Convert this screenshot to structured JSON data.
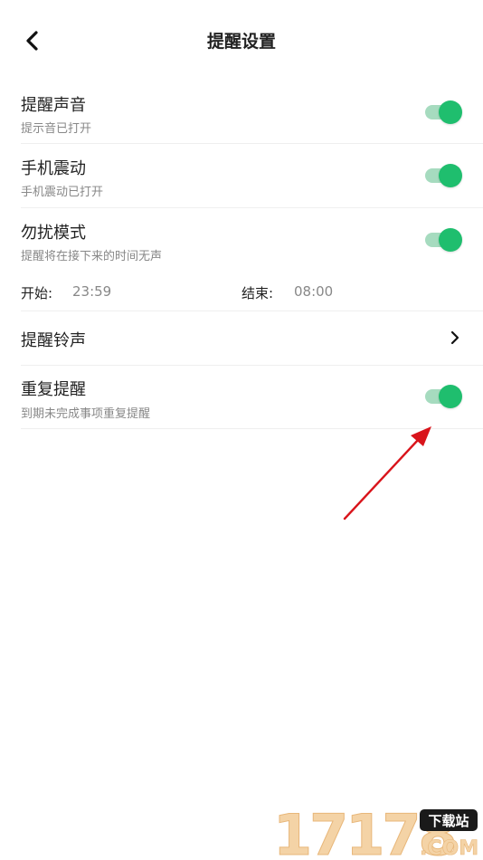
{
  "header": {
    "title": "提醒设置",
    "back_icon": "chevron-left-icon"
  },
  "settings": {
    "sound": {
      "title": "提醒声音",
      "subtitle": "提示音已打开",
      "enabled": true
    },
    "vibrate": {
      "title": "手机震动",
      "subtitle": "手机震动已打开",
      "enabled": true
    },
    "dnd": {
      "title": "勿扰模式",
      "subtitle": "提醒将在接下来的时间无声",
      "enabled": true,
      "start_label": "开始:",
      "start_time": "23:59",
      "end_label": "结束:",
      "end_time": "08:00"
    },
    "ringtone": {
      "title": "提醒铃声",
      "icon": "chevron-right-icon"
    },
    "repeat": {
      "title": "重复提醒",
      "subtitle": "到期未完成事项重复提醒",
      "enabled": true
    }
  },
  "colors": {
    "toggle_on": "#1fbe6e",
    "toggle_track": "#a6dbbf",
    "annotation_arrow": "#d9141b"
  },
  "watermark": {
    "number": "17178",
    "tag": "下载站",
    "domain": ".COM"
  }
}
